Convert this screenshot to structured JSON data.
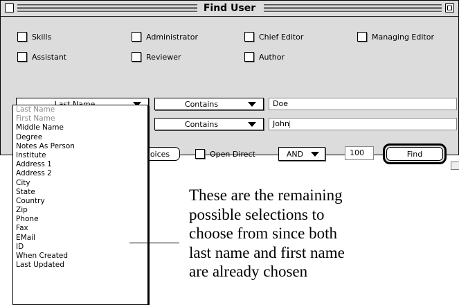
{
  "window": {
    "title": "Find User"
  },
  "checkboxes": [
    {
      "label": "Skills"
    },
    {
      "label": "Administrator"
    },
    {
      "label": "Chief Editor"
    },
    {
      "label": "Managing Editor"
    },
    {
      "label": "Assistant"
    },
    {
      "label": "Reviewer"
    },
    {
      "label": "Author"
    }
  ],
  "criteria": [
    {
      "field": "Last Name",
      "operator": "Contains",
      "value": "Doe"
    },
    {
      "field": "",
      "operator": "Contains",
      "value": "John"
    }
  ],
  "bottom": {
    "choices_label": "oices",
    "open_direct_label": "Open Direct",
    "logic_label": "AND",
    "limit_value": "100",
    "find_label": "Find"
  },
  "menu": {
    "items": [
      {
        "label": "Last Name",
        "enabled": false
      },
      {
        "label": "First Name",
        "enabled": false
      },
      {
        "label": "Middle Name",
        "enabled": true
      },
      {
        "label": "Degree",
        "enabled": true
      },
      {
        "label": "Notes As Person",
        "enabled": true
      },
      {
        "label": "Institute",
        "enabled": true
      },
      {
        "label": "Address 1",
        "enabled": true
      },
      {
        "label": "Address 2",
        "enabled": true
      },
      {
        "label": "City",
        "enabled": true
      },
      {
        "label": "State",
        "enabled": true
      },
      {
        "label": "Country",
        "enabled": true
      },
      {
        "label": "Zip",
        "enabled": true
      },
      {
        "label": "Phone",
        "enabled": true
      },
      {
        "label": "Fax",
        "enabled": true
      },
      {
        "label": "EMail",
        "enabled": true
      },
      {
        "label": "ID",
        "enabled": true
      },
      {
        "label": "When Created",
        "enabled": true
      },
      {
        "label": "Last Updated",
        "enabled": true
      }
    ]
  },
  "annotation": {
    "lines": [
      "These are the remaining",
      "possible selections to",
      "choose from since both",
      "last name and first name",
      "are already chosen"
    ]
  }
}
